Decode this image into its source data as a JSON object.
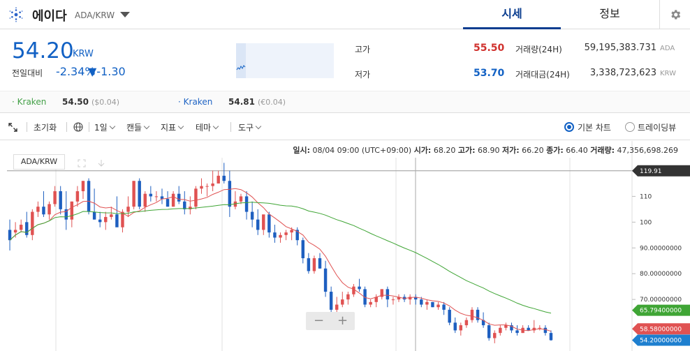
{
  "header": {
    "coin_name": "에이다",
    "pair": "ADA/KRW",
    "tabs": [
      {
        "label": "시세"
      },
      {
        "label": "정보"
      }
    ]
  },
  "summary": {
    "price": "54.20",
    "unit": "KRW",
    "change_label": "전일대비",
    "change_pct": "-2.34%",
    "change_val": "▼-1.30",
    "high_label": "고가",
    "high": "55.50",
    "low_label": "저가",
    "low": "53.70",
    "volume_label": "거래량(24H)",
    "volume": "59,195,383.731",
    "volume_unit": "ADA",
    "amount_label": "거래대금(24H)",
    "amount": "3,338,723,623",
    "amount_unit": "KRW"
  },
  "exchanges": [
    {
      "name": "Kraken",
      "price": "54.50",
      "diff": "($0.04)",
      "color": "#43a047"
    },
    {
      "name": "Kraken",
      "price": "54.81",
      "diff": "(€0.04)",
      "color": "#1e63c4"
    }
  ],
  "toolbar": {
    "reset": "초기화",
    "interval": "1일",
    "candle": "캔들",
    "indicator": "지표",
    "theme": "테마",
    "tools": "도구",
    "basic_chart": "기본 차트",
    "tradingview": "트레이딩뷰"
  },
  "ohlc": {
    "date_label": "일시:",
    "date": "08/04 09:00 (UTC+09:00)",
    "open_label": "시가:",
    "open": "68.20",
    "high_label": "고가:",
    "high": "68.90",
    "low_label": "저가:",
    "low": "66.20",
    "close_label": "종가:",
    "close": "66.40",
    "volume_label": "거래량:",
    "volume": "47,356,698.269"
  },
  "chart_symbol": "ADA/KRW",
  "chart_data": {
    "type": "candlestick",
    "y_ticks": [
      "110",
      "100",
      "90.00000000",
      "80.00000000",
      "70.00000000"
    ],
    "y_tick_values": [
      110,
      100,
      90,
      80,
      70
    ],
    "ylim": [
      50,
      125
    ],
    "markers": [
      {
        "label": "119.91",
        "value": 119.91,
        "color": "#333333"
      },
      {
        "label": "65.79400000",
        "value": 65.794,
        "color": "#3fa535"
      },
      {
        "label": "58.58000000",
        "value": 58.58,
        "color": "#e05252"
      },
      {
        "label": "54.20000000",
        "value": 54.2,
        "color": "#1e7fcf"
      }
    ],
    "up_color": "#e05252",
    "down_color": "#1e5fc0",
    "ma_short_color": "#e05252",
    "ma_long_color": "#3fa535",
    "candles": [
      [
        97.0,
        101.0,
        89.0,
        93.0
      ],
      [
        96.0,
        100.0,
        94.0,
        97.0
      ],
      [
        97.0,
        101.0,
        96.0,
        99.0
      ],
      [
        100.0,
        104.0,
        94.0,
        95.0
      ],
      [
        95.0,
        105.0,
        93.0,
        104.0
      ],
      [
        104.0,
        108.0,
        102.0,
        106.0
      ],
      [
        106.0,
        112.0,
        102.0,
        103.0
      ],
      [
        103.0,
        108.0,
        101.0,
        107.0
      ],
      [
        107.0,
        114.0,
        106.0,
        112.0
      ],
      [
        112.0,
        114.0,
        103.0,
        105.0
      ],
      [
        105.0,
        112.0,
        97.0,
        101.0
      ],
      [
        101.0,
        108.0,
        98.0,
        108.0
      ],
      [
        108.0,
        114.0,
        106.0,
        112.0
      ],
      [
        112.0,
        116.0,
        109.0,
        116.0
      ],
      [
        116.0,
        117.0,
        103.0,
        104.0
      ],
      [
        104.0,
        113.0,
        101.0,
        101.0
      ],
      [
        101.0,
        104.0,
        98.0,
        100.0
      ],
      [
        100.0,
        104.0,
        97.0,
        102.0
      ],
      [
        102.0,
        106.0,
        101.0,
        103.0
      ],
      [
        103.0,
        110.0,
        100.0,
        98.0
      ],
      [
        98.0,
        105.0,
        96.0,
        104.0
      ],
      [
        104.0,
        110.0,
        102.0,
        106.0
      ],
      [
        106.0,
        116.0,
        105.0,
        116.0
      ],
      [
        116.0,
        117.0,
        105.0,
        106.0
      ],
      [
        106.0,
        112.0,
        104.0,
        111.0
      ],
      [
        111.0,
        114.0,
        108.0,
        110.0
      ],
      [
        110.0,
        112.0,
        108.0,
        110.0
      ],
      [
        110.0,
        113.0,
        107.0,
        109.0
      ],
      [
        109.0,
        112.0,
        106.0,
        106.0
      ],
      [
        106.0,
        112.0,
        106.0,
        111.0
      ],
      [
        111.0,
        114.0,
        107.0,
        108.0
      ],
      [
        108.0,
        112.0,
        103.0,
        105.0
      ],
      [
        105.0,
        110.0,
        103.0,
        106.0
      ],
      [
        106.0,
        114.0,
        105.0,
        113.0
      ],
      [
        113.0,
        117.0,
        111.0,
        114.0
      ],
      [
        114.0,
        115.0,
        110.0,
        114.0
      ],
      [
        114.0,
        120.0,
        112.0,
        115.0
      ],
      [
        115.0,
        120.0,
        115.0,
        118.0
      ],
      [
        118.0,
        123.0,
        115.0,
        116.0
      ],
      [
        116.0,
        120.0,
        102.0,
        106.0
      ],
      [
        106.0,
        112.0,
        105.0,
        108.0
      ],
      [
        108.0,
        111.0,
        107.0,
        110.0
      ],
      [
        110.0,
        112.0,
        101.0,
        104.0
      ],
      [
        104.0,
        108.0,
        98.0,
        101.0
      ],
      [
        101.0,
        105.0,
        95.0,
        97.0
      ],
      [
        97.0,
        102.0,
        95.0,
        103.0
      ],
      [
        103.0,
        104.0,
        94.0,
        96.0
      ],
      [
        96.0,
        99.0,
        92.0,
        94.0
      ],
      [
        94.0,
        96.0,
        92.0,
        95.0
      ],
      [
        95.0,
        97.0,
        93.0,
        96.0
      ],
      [
        96.0,
        98.0,
        93.0,
        97.0
      ],
      [
        97.0,
        98.0,
        91.0,
        93.0
      ],
      [
        93.0,
        94.0,
        84.0,
        86.0
      ],
      [
        86.0,
        88.0,
        80.0,
        81.0
      ],
      [
        81.0,
        87.0,
        80.0,
        86.0
      ],
      [
        86.0,
        88.0,
        82.0,
        82.0
      ],
      [
        82.0,
        85.0,
        71.0,
        73.0
      ],
      [
        73.0,
        75.0,
        64.0,
        66.0
      ],
      [
        66.0,
        71.0,
        64.0,
        68.0
      ],
      [
        68.0,
        73.0,
        67.0,
        70.0
      ],
      [
        70.0,
        73.0,
        68.0,
        72.0
      ],
      [
        72.0,
        76.0,
        71.0,
        75.0
      ],
      [
        75.0,
        78.0,
        73.0,
        74.0
      ],
      [
        74.0,
        75.0,
        67.0,
        68.0
      ],
      [
        68.0,
        70.0,
        67.0,
        69.0
      ],
      [
        69.0,
        72.0,
        67.0,
        71.0
      ],
      [
        71.0,
        74.0,
        70.0,
        74.0
      ],
      [
        74.0,
        75.0,
        67.0,
        70.0
      ],
      [
        70.0,
        71.0,
        68.0,
        70.0
      ],
      [
        70.0,
        72.0,
        69.0,
        71.0
      ],
      [
        71.0,
        72.0,
        69.0,
        70.0
      ],
      [
        70.0,
        72.0,
        68.0,
        71.0
      ],
      [
        71.0,
        72.0,
        68.0,
        70.0
      ],
      [
        70.0,
        71.0,
        67.0,
        68.0
      ],
      [
        68.0,
        70.0,
        66.0,
        69.0
      ],
      [
        69.0,
        69.0,
        67.0,
        67.0
      ],
      [
        67.0,
        69.0,
        66.0,
        68.0
      ],
      [
        68.0,
        69.0,
        64.0,
        66.0
      ],
      [
        66.0,
        67.0,
        60.0,
        61.0
      ],
      [
        61.0,
        63.0,
        57.0,
        58.0
      ],
      [
        58.0,
        61.0,
        56.0,
        60.0
      ],
      [
        60.0,
        63.0,
        59.0,
        62.0
      ],
      [
        62.0,
        67.0,
        61.0,
        66.0
      ],
      [
        66.0,
        67.0,
        61.0,
        62.0
      ],
      [
        62.0,
        65.0,
        59.0,
        60.0
      ],
      [
        60.0,
        61.0,
        54.0,
        55.0
      ],
      [
        55.0,
        58.0,
        53.0,
        57.0
      ],
      [
        57.0,
        60.0,
        56.0,
        59.0
      ],
      [
        59.0,
        61.0,
        58.0,
        60.0
      ],
      [
        60.0,
        61.0,
        57.0,
        58.0
      ],
      [
        58.0,
        60.0,
        56.0,
        57.0
      ],
      [
        57.0,
        60.0,
        57.0,
        59.0
      ],
      [
        59.0,
        60.0,
        58.0,
        58.0
      ],
      [
        58.0,
        62.0,
        57.0,
        59.0
      ],
      [
        59.0,
        60.0,
        58.0,
        59.0
      ],
      [
        59.0,
        60.0,
        56.0,
        57.0
      ],
      [
        57.0,
        58.0,
        54.0,
        54.2
      ]
    ]
  }
}
